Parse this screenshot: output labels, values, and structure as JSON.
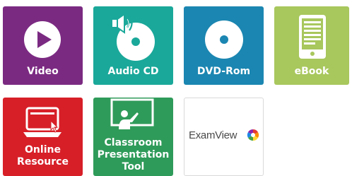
{
  "tiles": [
    {
      "id": "video",
      "label": "Video",
      "color": "#7b2a82",
      "icon": "play-icon"
    },
    {
      "id": "audio",
      "label": "Audio CD",
      "color": "#1aa89a",
      "icon": "cd-speaker-icon"
    },
    {
      "id": "dvd",
      "label": "DVD-Rom",
      "color": "#1b86b1",
      "icon": "disc-icon"
    },
    {
      "id": "ebook",
      "label": "eBook",
      "color": "#a8c75d",
      "icon": "ereader-icon"
    },
    {
      "id": "online",
      "label_lines": [
        "Online",
        "Resource"
      ],
      "color": "#d71f28",
      "icon": "laptop-cursor-icon"
    },
    {
      "id": "classroom",
      "label_lines": [
        "Classroom",
        "Presentation",
        "Tool"
      ],
      "color": "#2f9b5a",
      "icon": "presenter-board-icon"
    },
    {
      "id": "examview",
      "logo_text": "ExamView",
      "color": "#ffffff",
      "icon": "examview-logo"
    }
  ]
}
